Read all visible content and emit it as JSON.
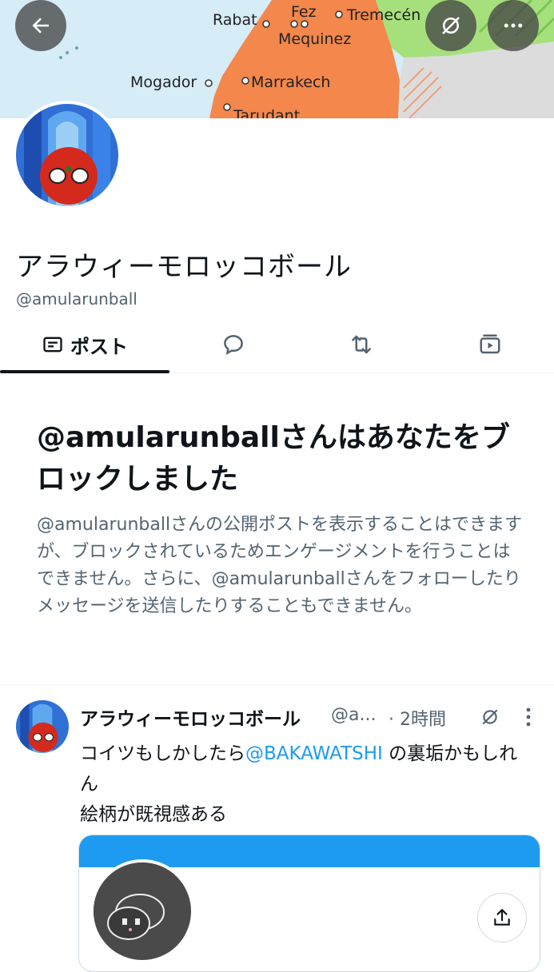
{
  "banner": {
    "map_labels": [
      "Rabat",
      "Fez",
      "Tremecén",
      "Mequinez",
      "Mogador",
      "Marrakech",
      "Tarudant"
    ]
  },
  "header": {
    "back_icon": "arrow-left-icon",
    "grok_icon": "slashed-circle-icon",
    "more_icon": "more-horizontal-icon"
  },
  "profile": {
    "name": "アラウィーモロッコボール",
    "handle": "@amularunball"
  },
  "tabs": [
    {
      "label": "ポスト",
      "icon": "posts-icon",
      "active": true
    },
    {
      "label": "",
      "icon": "reply-bubble-icon",
      "active": false
    },
    {
      "label": "",
      "icon": "repost-icon",
      "active": false
    },
    {
      "label": "",
      "icon": "media-icon",
      "active": false
    }
  ],
  "blocked": {
    "title": "@amularunballさんはあなたをブロックしました",
    "body": "@amularunballさんの公開ポストを表示することはできますが、ブロックされているためエンゲージメントを行うことはできません。さらに、@amularunballさんをフォローしたりメッセージを送信したりすることもできません。"
  },
  "post": {
    "author": "アラウィーモロッコボール",
    "handle": "@a...",
    "time": "· 2時間",
    "text_before": "コイツもしかしたら",
    "mention": "@BAKAWATSHI",
    "text_after": " の裏垢かもしれん",
    "line2": "絵柄が既視感ある"
  },
  "colors": {
    "accent": "#1d9bf0",
    "secondary_text": "#536471",
    "map_morocco": "#f4874b",
    "map_sea": "#d6ecf7",
    "map_algeria": "#a6e07c"
  }
}
